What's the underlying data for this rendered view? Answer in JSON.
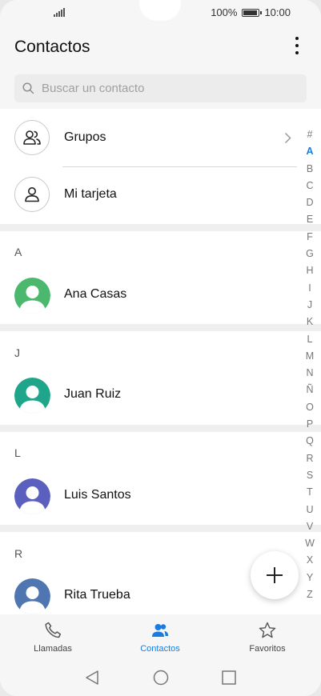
{
  "status": {
    "battery": "100%",
    "time": "10:00",
    "battery_level": 1.0
  },
  "header": {
    "title": "Contactos"
  },
  "search": {
    "placeholder": "Buscar un contacto"
  },
  "special_rows": [
    {
      "label": "Grupos"
    },
    {
      "label": "Mi tarjeta"
    }
  ],
  "sections": [
    {
      "letter": "A",
      "contact": "Ana Casas",
      "avatar_color": "#4cb86e"
    },
    {
      "letter": "J",
      "contact": "Juan Ruiz",
      "avatar_color": "#1fa58a"
    },
    {
      "letter": "L",
      "contact": "Luis Santos",
      "avatar_color": "#5b5fbd"
    },
    {
      "letter": "R",
      "contact": "Rita Trueba",
      "avatar_color": "#4f76b0"
    }
  ],
  "alphabet_index": [
    "#",
    "A",
    "B",
    "C",
    "D",
    "E",
    "F",
    "G",
    "H",
    "I",
    "J",
    "K",
    "L",
    "M",
    "N",
    "Ñ",
    "O",
    "P",
    "Q",
    "R",
    "S",
    "T",
    "U",
    "V",
    "W",
    "X",
    "Y",
    "Z"
  ],
  "alphabet_active": "A",
  "bottom_nav": [
    {
      "label": "Llamadas",
      "icon": "phone-icon"
    },
    {
      "label": "Contactos",
      "icon": "contacts-icon",
      "active": true
    },
    {
      "label": "Favoritos",
      "icon": "star-icon"
    }
  ],
  "colors": {
    "accent": "#1a7dde"
  }
}
